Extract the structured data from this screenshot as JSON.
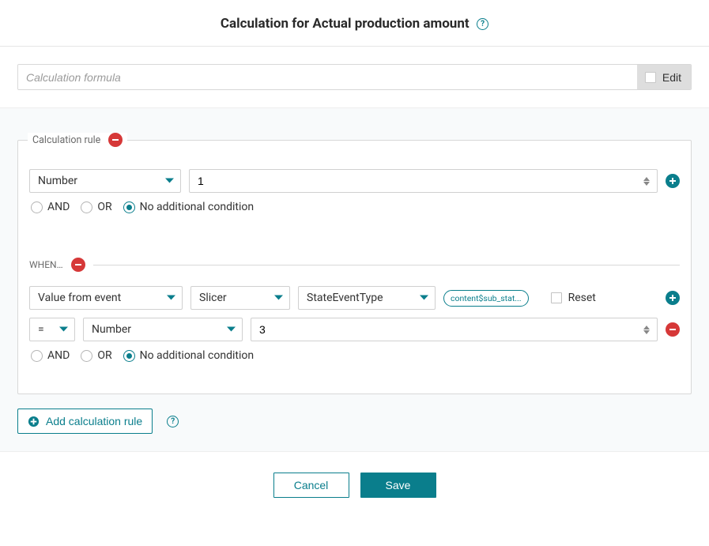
{
  "header": {
    "title": "Calculation for Actual production amount"
  },
  "formula": {
    "placeholder": "Calculation formula",
    "edit_label": "Edit"
  },
  "rule": {
    "legend": "Calculation rule",
    "type_select": "Number",
    "value": "1",
    "radios": {
      "and": "AND",
      "or": "OR",
      "none": "No additional condition"
    },
    "when": {
      "label": "WHEN…",
      "source_select": "Value from event",
      "entity_select": "Slicer",
      "field_select": "StateEventType",
      "pill": "content$sub_stat...",
      "reset_label": "Reset",
      "op_select": "=",
      "cmp_type_select": "Number",
      "cmp_value": "3",
      "radios": {
        "and": "AND",
        "or": "OR",
        "none": "No additional condition"
      }
    }
  },
  "actions": {
    "add_rule": "Add calculation rule",
    "cancel": "Cancel",
    "save": "Save"
  }
}
